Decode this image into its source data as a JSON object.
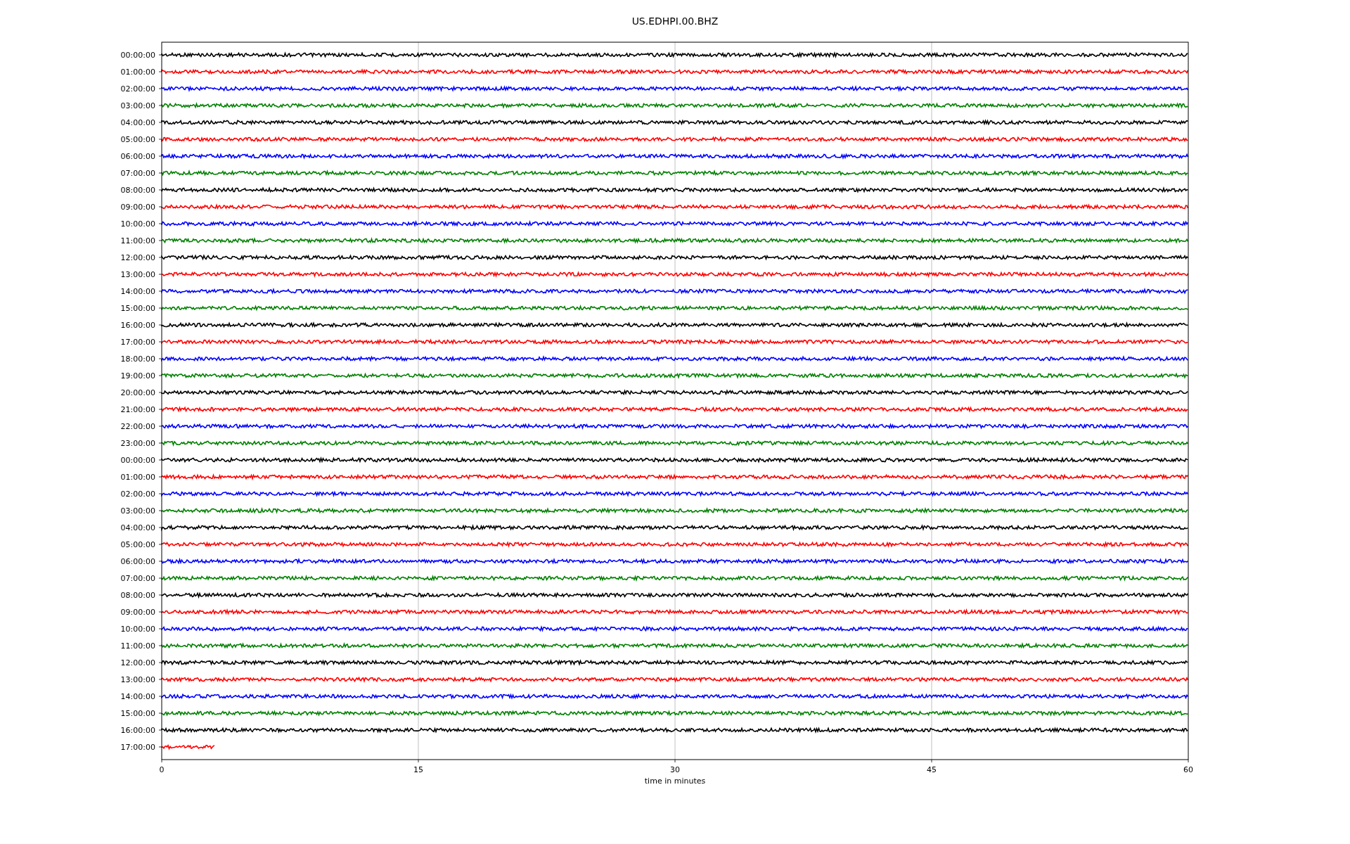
{
  "title": "US.EDHPI.00.BHZ",
  "rows": [
    {
      "time": "00:00:00",
      "color": "#000000",
      "kind": "full"
    },
    {
      "time": "01:00:00",
      "color": "#ff0000",
      "kind": "full"
    },
    {
      "time": "02:00:00",
      "color": "#0000ff",
      "kind": "full"
    },
    {
      "time": "03:00:00",
      "color": "#008000",
      "kind": "full"
    },
    {
      "time": "04:00:00",
      "color": "#000000",
      "kind": "full"
    },
    {
      "time": "05:00:00",
      "color": "#ff0000",
      "kind": "full"
    },
    {
      "time": "06:00:00",
      "color": "#0000ff",
      "kind": "full"
    },
    {
      "time": "07:00:00",
      "color": "#008000",
      "kind": "full"
    },
    {
      "time": "08:00:00",
      "color": "#000000",
      "kind": "full"
    },
    {
      "time": "09:00:00",
      "color": "#ff0000",
      "kind": "full"
    },
    {
      "time": "10:00:00",
      "color": "#0000ff",
      "kind": "full"
    },
    {
      "time": "11:00:00",
      "color": "#008000",
      "kind": "full"
    },
    {
      "time": "12:00:00",
      "color": "#000000",
      "kind": "full"
    },
    {
      "time": "13:00:00",
      "color": "#ff0000",
      "kind": "full"
    },
    {
      "time": "14:00:00",
      "color": "#0000ff",
      "kind": "full"
    },
    {
      "time": "15:00:00",
      "color": "#008000",
      "kind": "full"
    },
    {
      "time": "16:00:00",
      "color": "#000000",
      "kind": "full"
    },
    {
      "time": "17:00:00",
      "color": "#ff0000",
      "kind": "full"
    },
    {
      "time": "18:00:00",
      "color": "#0000ff",
      "kind": "full"
    },
    {
      "time": "19:00:00",
      "color": "#008000",
      "kind": "full"
    },
    {
      "time": "20:00:00",
      "color": "#000000",
      "kind": "full"
    },
    {
      "time": "21:00:00",
      "color": "#ff0000",
      "kind": "full"
    },
    {
      "time": "22:00:00",
      "color": "#0000ff",
      "kind": "full"
    },
    {
      "time": "23:00:00",
      "color": "#008000",
      "kind": "full"
    },
    {
      "time": "00:00:00",
      "color": "#000000",
      "kind": "full"
    },
    {
      "time": "01:00:00",
      "color": "#ff0000",
      "kind": "full"
    },
    {
      "time": "02:00:00",
      "color": "#0000ff",
      "kind": "full"
    },
    {
      "time": "03:00:00",
      "color": "#008000",
      "kind": "full"
    },
    {
      "time": "04:00:00",
      "color": "#000000",
      "kind": "full"
    },
    {
      "time": "05:00:00",
      "color": "#ff0000",
      "kind": "full"
    },
    {
      "time": "06:00:00",
      "color": "#0000ff",
      "kind": "full"
    },
    {
      "time": "07:00:00",
      "color": "#008000",
      "kind": "full"
    },
    {
      "time": "08:00:00",
      "color": "#000000",
      "kind": "full"
    },
    {
      "time": "09:00:00",
      "color": "#ff0000",
      "kind": "full"
    },
    {
      "time": "10:00:00",
      "color": "#0000ff",
      "kind": "full"
    },
    {
      "time": "11:00:00",
      "color": "#008000",
      "kind": "full"
    },
    {
      "time": "12:00:00",
      "color": "#000000",
      "kind": "full"
    },
    {
      "time": "13:00:00",
      "color": "#ff0000",
      "kind": "full"
    },
    {
      "time": "14:00:00",
      "color": "#0000ff",
      "kind": "full"
    },
    {
      "time": "15:00:00",
      "color": "#008000",
      "kind": "full"
    },
    {
      "time": "16:00:00",
      "color": "#000000",
      "kind": "full"
    },
    {
      "time": "17:00:00",
      "color": "#ff0000",
      "kind": "partial"
    }
  ],
  "x_axis": {
    "label": "time in minutes",
    "ticks": [
      "0",
      "15",
      "30",
      "45",
      "60"
    ]
  }
}
